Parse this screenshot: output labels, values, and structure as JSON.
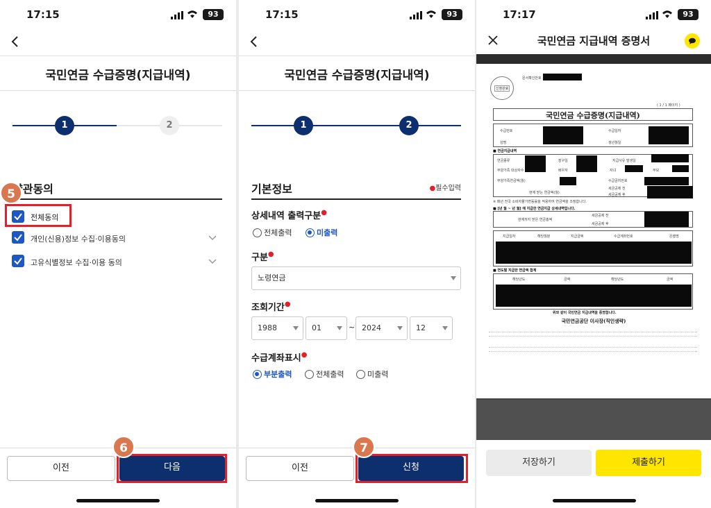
{
  "status": {
    "time1": "17:15",
    "time2": "17:15",
    "time3": "17:17",
    "battery": "93"
  },
  "screen1": {
    "title": "국민연금 수급증명(지급내역)",
    "steps": [
      "1",
      "2"
    ],
    "section_title": "약관동의",
    "agree_all": "전체동의",
    "items": [
      "개인(신용)정보 수집·이용동의",
      "고유식별정보 수집·이용 동의"
    ],
    "badge_5": "5",
    "badge_6": "6",
    "prev": "이전",
    "next": "다음"
  },
  "screen2": {
    "title": "국민연금 수급증명(지급내역)",
    "steps": [
      "1",
      "2"
    ],
    "section_title": "기본정보",
    "required_note": "필수입력",
    "detail_label": "상세내역 출력구분",
    "detail_options": [
      "전체출력",
      "미출력"
    ],
    "type_label": "구분",
    "type_value": "노령연금",
    "period_label": "조회기간",
    "period": {
      "from_year": "1988",
      "from_month": "01",
      "tilde": "~",
      "to_year": "2024",
      "to_month": "12"
    },
    "account_label": "수급계좌표시",
    "account_options": [
      "부분출력",
      "전체출력",
      "미출력"
    ],
    "badge_7": "7",
    "prev": "이전",
    "submit": "신청"
  },
  "screen3": {
    "title": "국민연금 지급내역 증명서",
    "doc": {
      "page_indicator": "( 1 / 1 페이지 )",
      "doc_no_label": "문서확인번호 :",
      "heading": "국민연금 수급증명(지급내역)",
      "row_labels": [
        "수급번호",
        "수급일자",
        "성명",
        "생년월일"
      ],
      "sec1": "■ 연금지급내역",
      "sec1_labels": [
        "연금종류",
        "장구일",
        "지급사유 발생일",
        "부양가족 대상자수",
        "배우자",
        "자녀",
        "부모",
        "부양가족연금액(월)",
        "수급금지번호",
        "현재 받는 연금액(월)",
        "세금공제 전",
        "세금공제 후"
      ],
      "note1": "※ 매년 전국 소비자물가변동률을 적용하여 연금액을 조정합니다.",
      "sec2": "■ [년 월 ~ 년 월] 에 지급한 연금지급 상세내역입니다.",
      "sec2_labels": [
        "현재까지 받은 연금총액",
        "세금공제 전",
        "세금공제 후"
      ],
      "sec2_cols": [
        "지급일자",
        "해당월분",
        "지급금액",
        "수급계좌번호",
        "은행명"
      ],
      "sec3": "■ 연도별 지급한 연금액 합계",
      "sec3_cols": [
        "해당년도",
        "금액",
        "해당년도",
        "금액"
      ],
      "certify": "위와 같이 국민연금 지급내역을 증명합니다.",
      "issuer": "국민연금공단 이사장(직인생략)",
      "seal": "신청완료"
    },
    "save": "저장하기",
    "submit": "제출하기"
  }
}
